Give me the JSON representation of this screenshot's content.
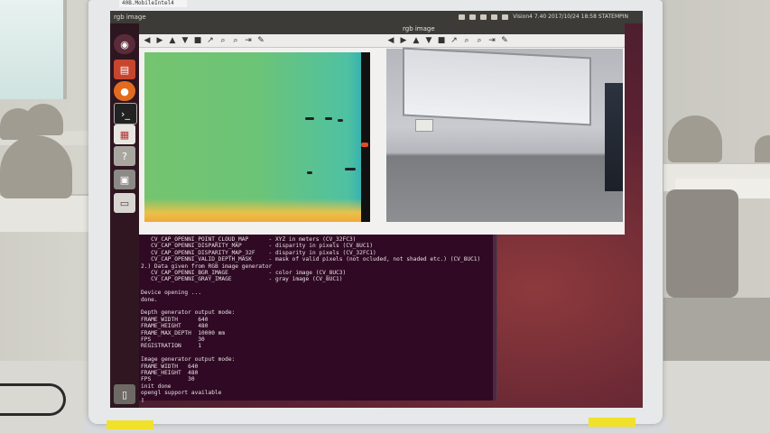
{
  "sticker_label": "40B.MobileIntel4",
  "desktop": {
    "top_panel_title": "rgb image",
    "clock": "Vision4 7.40 2017/10/24 18:58 STATEMPIN"
  },
  "windows": {
    "depth": {
      "title": ""
    },
    "rgb": {
      "title": "rgb image"
    },
    "toolbar_icons": [
      "◀",
      "▶",
      "▲",
      "▼",
      "■",
      "↗",
      "⌕",
      "⌕",
      "⇥",
      "✎"
    ]
  },
  "terminal": {
    "lines": [
      "   CV_CAP_OPENNI_POINT_CLOUD_MAP      - XYZ in meters (CV_32FC3)",
      "   CV_CAP_OPENNI_DISPARITY_MAP        - disparity in pixels (CV_8UC1)",
      "   CV_CAP_OPENNI_DISPARITY_MAP_32F    - disparity in pixels (CV_32FC1)",
      "   CV_CAP_OPENNI_VALID_DEPTH_MASK     - mask of valid pixels (not ocluded, not shaded etc.) (CV_8UC1)",
      "2.) Data given from RGB image generator",
      "   CV_CAP_OPENNI_BGR_IMAGE            - color image (CV_8UC3)",
      "   CV_CAP_OPENNI_GRAY_IMAGE           - gray image (CV_8UC1)",
      "",
      "Device opening ...",
      "done.",
      "",
      "Depth generator output mode:",
      "FRAME_WIDTH      640",
      "FRAME_HEIGHT     480",
      "FRAME_MAX_DEPTH  10000 mm",
      "FPS              30",
      "REGISTRATION     1",
      "",
      "Image generator output mode:",
      "FRAME_WIDTH   640",
      "FRAME_HEIGHT  480",
      "FPS           30",
      "init done",
      "opengl support available",
      "▯"
    ]
  }
}
